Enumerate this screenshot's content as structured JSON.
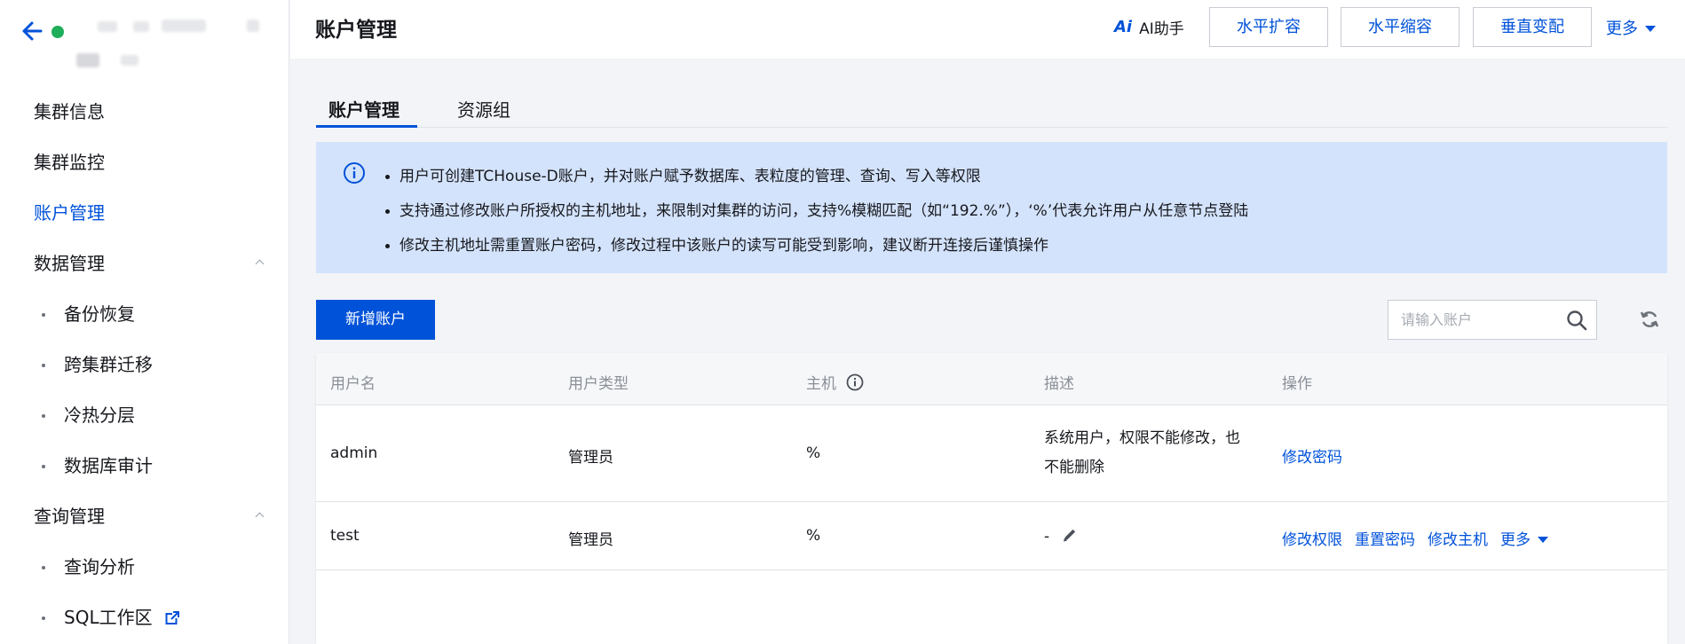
{
  "sidebar": {
    "nav": [
      {
        "label": "集群信息"
      },
      {
        "label": "集群监控"
      },
      {
        "label": "账户管理",
        "active": true
      }
    ],
    "data_group": {
      "label": "数据管理",
      "items": [
        "备份恢复",
        "跨集群迁移",
        "冷热分层",
        "数据库审计"
      ]
    },
    "query_group": {
      "label": "查询管理",
      "items": [
        "查询分析",
        "SQL工作区"
      ]
    }
  },
  "topbar": {
    "title": "账户管理",
    "ai_icon": "Ai",
    "ai_label": "AI助手",
    "buttons": [
      "水平扩容",
      "水平缩容",
      "垂直变配"
    ],
    "more": "更多"
  },
  "tabs": [
    "账户管理",
    "资源组"
  ],
  "banner": {
    "lines": [
      "用户可创建TCHouse-D账户，并对账户赋予数据库、表粒度的管理、查询、写入等权限",
      "支持通过修改账户所授权的主机地址，来限制对集群的访问，支持%模糊匹配（如“192.%”），‘%’代表允许用户从任意节点登陆",
      "修改主机地址需重置账户密码，修改过程中该账户的读写可能受到影响，建议断开连接后谨慎操作"
    ]
  },
  "toolbar": {
    "add_label": "新增账户",
    "search_placeholder": "请输入账户"
  },
  "table": {
    "headers": [
      "用户名",
      "用户类型",
      "主机",
      "描述",
      "操作"
    ],
    "rows": [
      {
        "username": "admin",
        "type": "管理员",
        "host": "%",
        "desc_line1": "系统用户，权限不能修改，也",
        "desc_line2": "不能删除",
        "ops": [
          "修改密码"
        ]
      },
      {
        "username": "test",
        "type": "管理员",
        "host": "%",
        "desc": "-",
        "ops": [
          "修改权限",
          "重置密码",
          "修改主机"
        ],
        "more": "更多"
      }
    ]
  },
  "colors": {
    "accent": "#0052d9",
    "banner_bg": "#d4e3fc",
    "status": "#1fae5a"
  }
}
